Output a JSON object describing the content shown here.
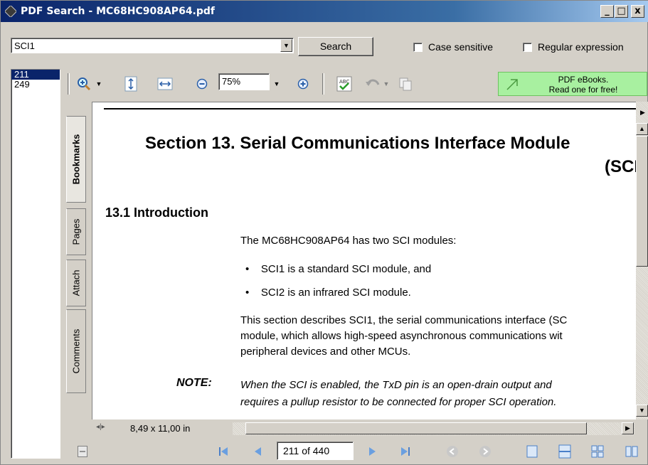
{
  "window": {
    "title": "PDF Search - MC68HC908AP64.pdf",
    "buttons": {
      "minimize": "_",
      "maximize": "□",
      "close": "x"
    }
  },
  "search": {
    "query": "SCI1",
    "search_button": "Search",
    "case_sensitive": {
      "label": "Case sensitive",
      "checked": false
    },
    "regex": {
      "label": "Regular expression",
      "checked": false
    }
  },
  "results": [
    {
      "page": "211",
      "selected": true
    },
    {
      "page": "249",
      "selected": false
    }
  ],
  "toolbar": {
    "zoom": "75%",
    "promo_line1": "PDF eBooks.",
    "promo_line2": "Read one for free!"
  },
  "side_tabs": {
    "bookmarks": "Bookmarks",
    "pages": "Pages",
    "attach": "Attach",
    "comments": "Comments"
  },
  "document": {
    "section_title_line1": "Section 13.  Serial Communications Interface Module",
    "section_title_line2": "(SCI",
    "heading": "13.1  Introduction",
    "intro": "The MC68HC908AP64 has two SCI modules:",
    "bullets": [
      "SCI1 is a standard SCI module, and",
      "SCI2 is an infrared SCI module."
    ],
    "para_lines": [
      "This section describes SCI1, the serial communications interface (SC",
      "module, which allows high-speed asynchronous communications wit",
      "peripheral devices and other MCUs."
    ],
    "note_label": "NOTE:",
    "note_lines": [
      "When the SCI is enabled, the TxD pin is an open-drain output and",
      "requires a pullup resistor to be connected for proper SCI operation."
    ]
  },
  "status": {
    "page_size": "8,49 x 11,00 in"
  },
  "navigation": {
    "page_indicator": "211 of 440"
  }
}
